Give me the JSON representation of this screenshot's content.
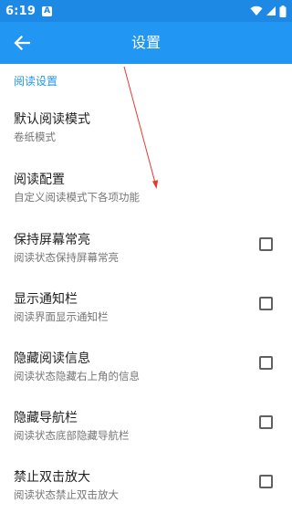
{
  "status_bar": {
    "time": "6:19",
    "notification_icon": "A",
    "icons": [
      "wifi-icon",
      "signal-icon",
      "battery-icon"
    ]
  },
  "app_bar": {
    "title": "设置",
    "back_icon": "arrow-left-icon"
  },
  "section": {
    "header": "阅读设置"
  },
  "prefs": [
    {
      "title": "默认阅读模式",
      "summary": "卷纸模式",
      "has_checkbox": false
    },
    {
      "title": "阅读配置",
      "summary": "自定义阅读模式下各项功能",
      "has_checkbox": false
    },
    {
      "title": "保持屏幕常亮",
      "summary": "阅读状态保持屏幕常亮",
      "has_checkbox": true,
      "checked": false
    },
    {
      "title": "显示通知栏",
      "summary": "阅读界面显示通知栏",
      "has_checkbox": true,
      "checked": false
    },
    {
      "title": "隐藏阅读信息",
      "summary": "阅读状态隐藏右上角的信息",
      "has_checkbox": true,
      "checked": false
    },
    {
      "title": "隐藏导航栏",
      "summary": "阅读状态底部隐藏导航栏",
      "has_checkbox": true,
      "checked": false
    },
    {
      "title": "禁止双击放大",
      "summary": "阅读状态禁止双击放大",
      "has_checkbox": true,
      "checked": false
    }
  ],
  "colors": {
    "status_bar": "#1e88e5",
    "app_bar": "#2196f3",
    "accent": "#2196f3",
    "annotation_arrow": "#e53935"
  }
}
